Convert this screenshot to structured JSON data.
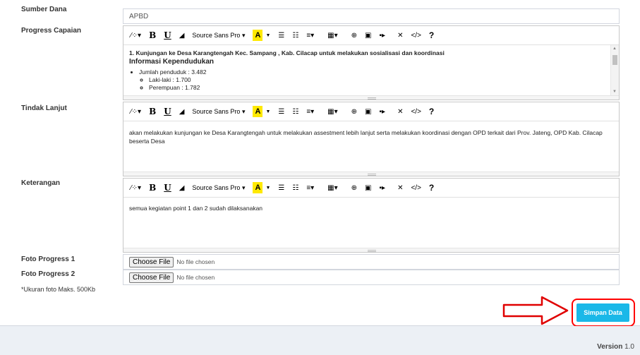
{
  "labels": {
    "sumber_dana": "Sumber Dana",
    "progress_capaian": "Progress Capaian",
    "tindak_lanjut": "Tindak Lanjut",
    "keterangan": "Keterangan",
    "foto_progress_1": "Foto Progress 1",
    "foto_progress_2": "Foto Progress 2",
    "note": "*Ukuran foto Maks. 500Kb"
  },
  "sumber_dana_value": "APBD",
  "toolbar": {
    "font_name": "Source Sans Pro",
    "highlight_letter": "A",
    "question": "?",
    "code": "</>"
  },
  "progress": {
    "heading": "1. Kunjungan ke Desa Karangtengah Kec. Sampang , Kab. Cilacap  untuk melakukan sosialisasi dan koordinasi",
    "subheading": "Informasi Kependudukan",
    "bullet_1": "Jumlah penduduk : 3.482",
    "sub_bullet_1": "Laki-laki : 1.700",
    "sub_bullet_2": "Perempuan : 1.782"
  },
  "tindak_lanjut_text": "akan melakukan kunjungan ke Desa Karangtengah  untuk melakukan assestment  lebih lanjut serta melakukan koordinasi dengan OPD terkait dari Prov. Jateng, OPD Kab. Cilacap beserta Desa",
  "keterangan_text": "semua kegiatan point 1 dan 2 sudah dilaksanakan",
  "file": {
    "button_label": "Choose File",
    "status": "No file chosen"
  },
  "submit_label": "Simpan Data",
  "footer": {
    "version_label": "Version",
    "version_number": "1.0"
  },
  "colors": {
    "accent": "#1ab8e8",
    "highlight": "#ff0000"
  }
}
